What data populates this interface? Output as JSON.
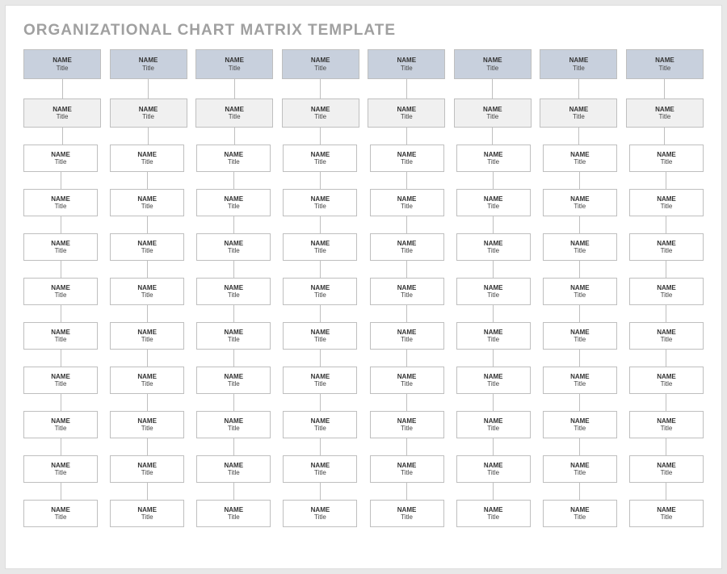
{
  "page_title": "ORGANIZATIONAL CHART MATRIX TEMPLATE",
  "columns": 8,
  "rows": 11,
  "cells": {
    "name_label": "NAME",
    "title_label": "Title"
  }
}
